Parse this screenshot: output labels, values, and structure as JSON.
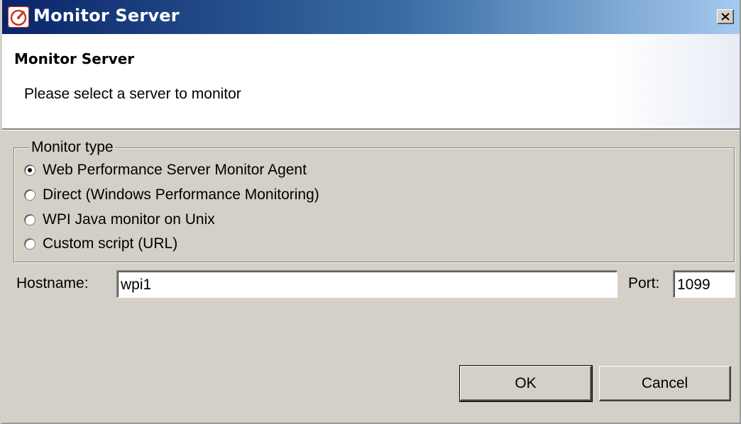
{
  "window": {
    "title": "Monitor Server",
    "icon": "speedometer-icon",
    "close_icon": "close-icon"
  },
  "banner": {
    "heading": "Monitor Server",
    "message": "Please select a server to monitor"
  },
  "monitor_type": {
    "legend": "Monitor type",
    "selected": "Web Performance Server Monitor Agent",
    "options": [
      {
        "label": "Web Performance Server Monitor Agent",
        "checked": true
      },
      {
        "label": "Direct (Windows Performance Monitoring)",
        "checked": false
      },
      {
        "label": "WPI Java monitor on Unix",
        "checked": false
      },
      {
        "label": "Custom script (URL)",
        "checked": false
      }
    ]
  },
  "hostname": {
    "label": "Hostname:",
    "value": "wpi1"
  },
  "port": {
    "label": "Port:",
    "value": "1099"
  },
  "buttons": {
    "ok": "OK",
    "cancel": "Cancel"
  },
  "colors": {
    "title_gradient_start": "#0a246a",
    "title_gradient_end": "#a6caf0",
    "dialog_bg": "#d4d0c8"
  }
}
